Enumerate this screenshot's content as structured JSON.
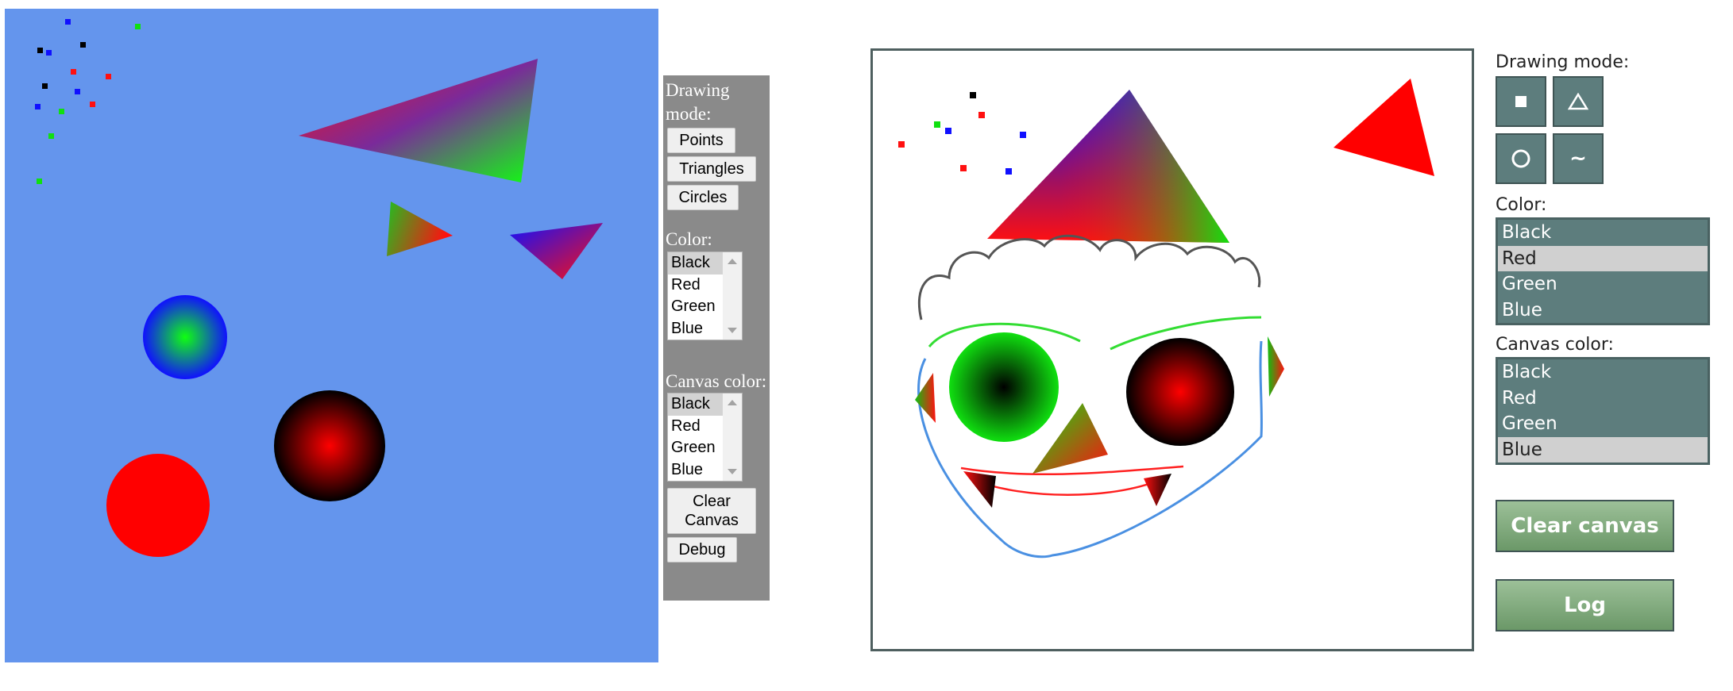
{
  "left_app": {
    "canvas": {
      "background": "#6495ed"
    },
    "panel": {
      "drawing_mode_label": "Drawing mode:",
      "buttons": {
        "points": "Points",
        "triangles": "Triangles",
        "circles": "Circles",
        "clear": "Clear Canvas",
        "debug": "Debug"
      },
      "color_label": "Color:",
      "color_options": [
        "Black",
        "Red",
        "Green",
        "Blue"
      ],
      "color_selected": "Black",
      "canvas_color_label": "Canvas color:",
      "canvas_color_options": [
        "Black",
        "Red",
        "Green",
        "Blue"
      ],
      "canvas_color_selected": "Black"
    }
  },
  "right_app": {
    "panel": {
      "drawing_mode_label": "Drawing mode:",
      "mode_icons": [
        "square-icon",
        "triangle-icon",
        "circle-icon",
        "tilde-icon"
      ],
      "mode_glyphs": {
        "square": "■",
        "triangle": "△",
        "circle": "○",
        "tilde": "~"
      },
      "color_label": "Color:",
      "color_options": [
        "Black",
        "Red",
        "Green",
        "Blue"
      ],
      "color_selected": "Red",
      "canvas_color_label": "Canvas color:",
      "canvas_color_options": [
        "Black",
        "Red",
        "Green",
        "Blue"
      ],
      "canvas_color_selected": "Blue",
      "clear_button": "Clear canvas",
      "log_button": "Log"
    },
    "colors": {
      "panel": "#5d7d7d",
      "button_green": "#86ad82",
      "selected": "#d0d0d0"
    }
  }
}
